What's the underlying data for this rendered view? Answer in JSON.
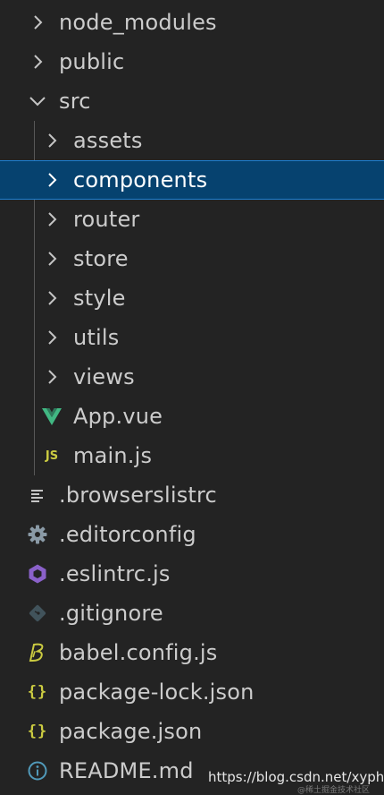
{
  "explorer": {
    "items": [
      {
        "label": "node_modules",
        "icon": "chevron-right-icon"
      },
      {
        "label": "public",
        "icon": "chevron-right-icon"
      },
      {
        "label": "src",
        "icon": "chevron-down-icon"
      },
      {
        "label": "assets",
        "icon": "chevron-right-icon"
      },
      {
        "label": "components",
        "icon": "chevron-right-icon",
        "selected": true
      },
      {
        "label": "router",
        "icon": "chevron-right-icon"
      },
      {
        "label": "store",
        "icon": "chevron-right-icon"
      },
      {
        "label": "style",
        "icon": "chevron-right-icon"
      },
      {
        "label": "utils",
        "icon": "chevron-right-icon"
      },
      {
        "label": "views",
        "icon": "chevron-right-icon"
      },
      {
        "label": "App.vue",
        "icon": "vue-icon"
      },
      {
        "label": "main.js",
        "icon": "js-icon",
        "icon_text": "JS"
      },
      {
        "label": ".browserslistrc",
        "icon": "lines-icon"
      },
      {
        "label": ".editorconfig",
        "icon": "gear-icon"
      },
      {
        "label": ".eslintrc.js",
        "icon": "eslint-icon"
      },
      {
        "label": ".gitignore",
        "icon": "git-icon"
      },
      {
        "label": "babel.config.js",
        "icon": "babel-icon"
      },
      {
        "label": "package-lock.json",
        "icon": "json-icon",
        "icon_text": "{}"
      },
      {
        "label": "package.json",
        "icon": "json-icon",
        "icon_text": "{}"
      },
      {
        "label": "README.md",
        "icon": "info-icon"
      }
    ]
  },
  "watermark": {
    "text": "https://blog.csdn.net/xyphf",
    "subtext": "@稀土掘金技术社区"
  },
  "colors": {
    "background": "#232323",
    "selection": "#06426f",
    "selection_border": "#1d7fd1",
    "text": "#cccccc",
    "vue_green": "#41b883",
    "js_yellow": "#cbcb41",
    "eslint_purple": "#8a61c9",
    "info_blue": "#519aba"
  }
}
